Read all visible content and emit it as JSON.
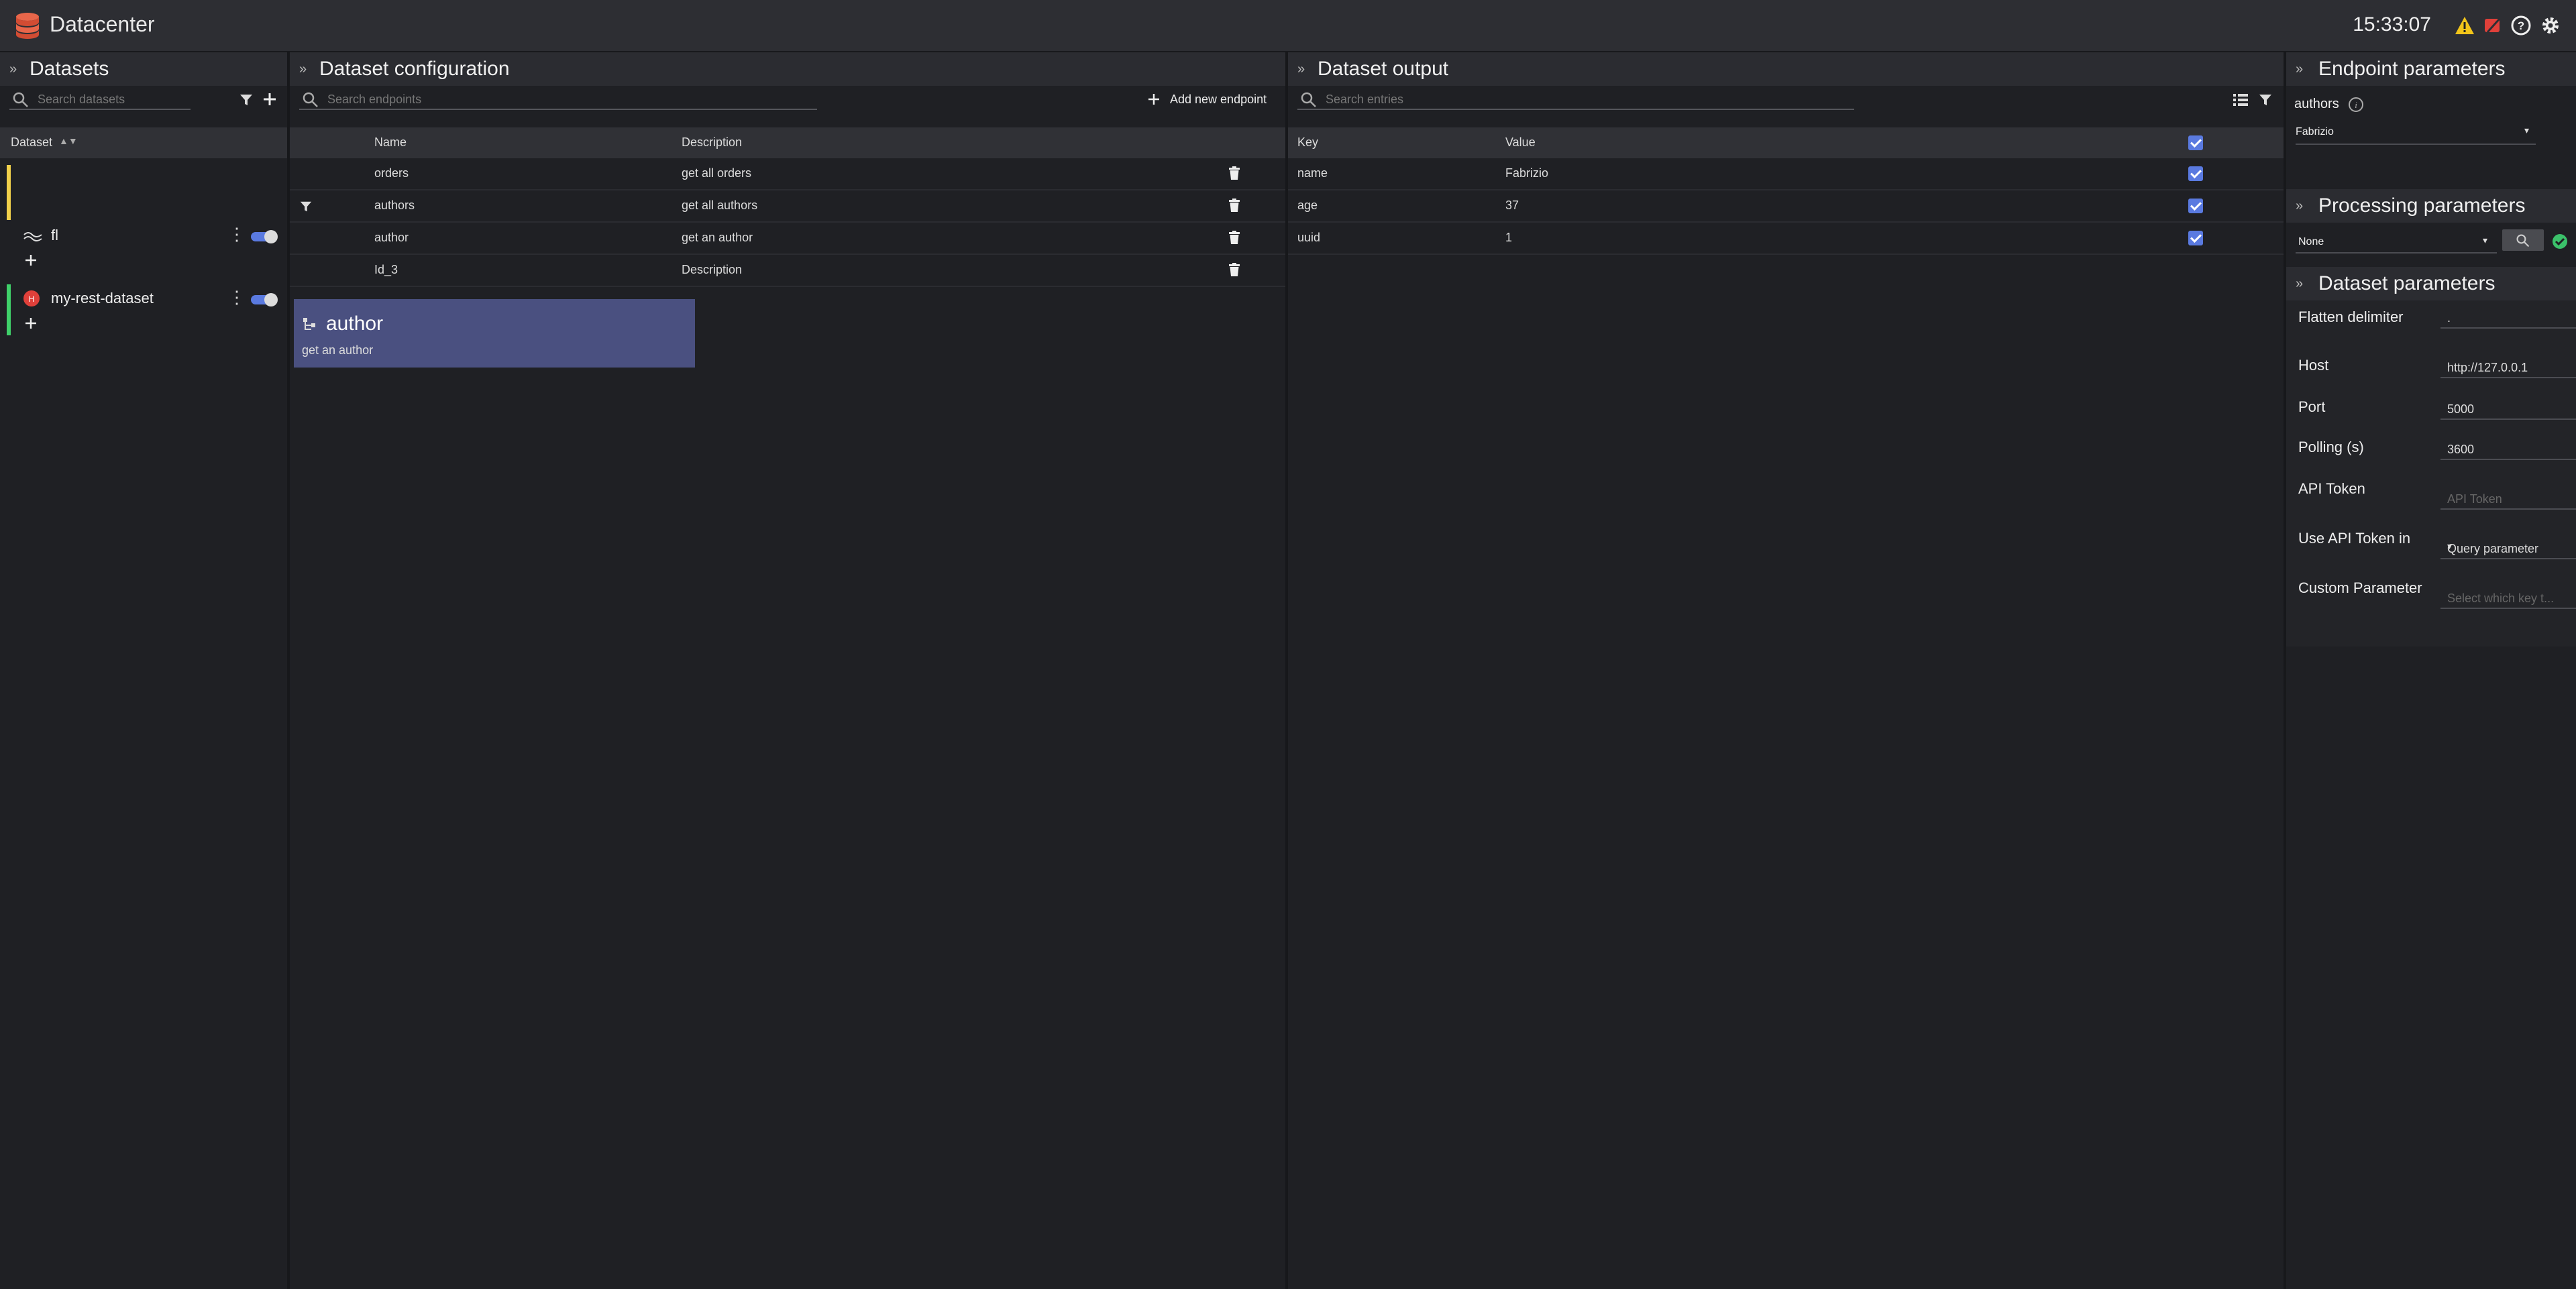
{
  "app": {
    "title": "Datacenter",
    "clock": "15:33:07"
  },
  "datasets_panel": {
    "title": "Datasets",
    "search_placeholder": "Search datasets",
    "column_header": "Dataset",
    "items": [
      {
        "name": "fl",
        "accent": "#f2d14b",
        "icon": "wave-icon"
      },
      {
        "name": "my-rest-dataset",
        "accent": "#3fd16a",
        "icon": "rest-icon"
      }
    ]
  },
  "config_panel": {
    "title": "Dataset configuration",
    "search_placeholder": "Search endpoints",
    "add_label": "Add new endpoint",
    "columns": {
      "name": "Name",
      "description": "Description"
    },
    "rows": [
      {
        "name": "orders",
        "description": "get all orders"
      },
      {
        "name": "authors",
        "description": "get all authors"
      },
      {
        "name": "author",
        "description": "get an author"
      },
      {
        "name": "Id_3",
        "description": "Description"
      }
    ],
    "drag_card": {
      "title": "author",
      "subtitle": "get an author"
    }
  },
  "output_panel": {
    "title": "Dataset output",
    "search_placeholder": "Search entries",
    "columns": {
      "key": "Key",
      "value": "Value"
    },
    "rows": [
      {
        "key": "name",
        "value": "Fabrizio"
      },
      {
        "key": "age",
        "value": "37"
      },
      {
        "key": "uuid",
        "value": "1"
      }
    ]
  },
  "params_panel": {
    "endpoint_title": "Endpoint parameters",
    "endpoint_name": "authors",
    "endpoint_select": "Fabrizio",
    "processing_title": "Processing parameters",
    "processing_select": "None",
    "dataset_title": "Dataset parameters",
    "fields": {
      "flatten_label": "Flatten delimiter",
      "flatten_value": ".",
      "host_label": "Host",
      "host_value": "http://127.0.0.1",
      "port_label": "Port",
      "port_value": "5000",
      "polling_label": "Polling (s)",
      "polling_value": "3600",
      "token_label": "API Token",
      "token_placeholder": "API Token",
      "token_in_label": "Use API Token in",
      "token_in_value": "Query parameter",
      "custom_label": "Custom Parameter",
      "custom_placeholder": "Select which key t..."
    }
  },
  "colors": {
    "accent": "#5a7ae0",
    "warning": "#f2c51a",
    "error": "#e0403a",
    "ok": "#3bc16a",
    "card": "#4a5080"
  }
}
